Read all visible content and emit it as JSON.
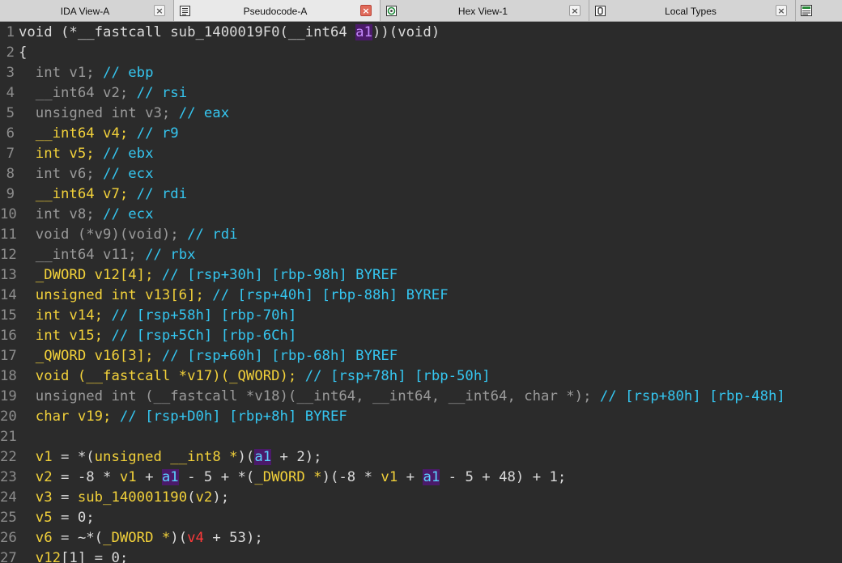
{
  "tabs": [
    {
      "label": "IDA View-A",
      "active": false,
      "icon": "none",
      "width": 215
    },
    {
      "label": "Pseudocode-A",
      "active": true,
      "icon": "document-icon",
      "width": 255
    },
    {
      "label": "Hex View-1",
      "active": false,
      "icon": "hex-icon",
      "width": 258
    },
    {
      "label": "Local Types",
      "active": false,
      "icon": "types-icon",
      "width": 255
    },
    {
      "label": "",
      "active": false,
      "icon": "structures-icon",
      "width": 57
    }
  ],
  "code_lines": [
    {
      "n": "1",
      "parts": [
        [
          "void (*__fastcall sub_1400019F0(__int64 ",
          "kw"
        ],
        [
          "a1",
          "hl"
        ],
        [
          "))(void)",
          "kw"
        ]
      ]
    },
    {
      "n": "2",
      "parts": [
        [
          "{",
          "kw"
        ]
      ]
    },
    {
      "n": "3",
      "parts": [
        [
          "  int v1; ",
          "kg"
        ],
        [
          "// ebp",
          "cm"
        ]
      ]
    },
    {
      "n": "4",
      "parts": [
        [
          "  __int64 v2; ",
          "kg"
        ],
        [
          "// rsi",
          "cm"
        ]
      ]
    },
    {
      "n": "5",
      "parts": [
        [
          "  unsigned int v3; ",
          "kg"
        ],
        [
          "// eax",
          "cm"
        ]
      ]
    },
    {
      "n": "6",
      "parts": [
        [
          "  __int64 v4; ",
          "yl"
        ],
        [
          "// r9",
          "cm"
        ]
      ]
    },
    {
      "n": "7",
      "parts": [
        [
          "  int v5; ",
          "yl"
        ],
        [
          "// ebx",
          "cm"
        ]
      ]
    },
    {
      "n": "8",
      "parts": [
        [
          "  int v6; ",
          "kg"
        ],
        [
          "// ecx",
          "cm"
        ]
      ]
    },
    {
      "n": "9",
      "parts": [
        [
          "  __int64 v7; ",
          "yl"
        ],
        [
          "// rdi",
          "cm"
        ]
      ]
    },
    {
      "n": "10",
      "parts": [
        [
          "  int v8; ",
          "kg"
        ],
        [
          "// ecx",
          "cm"
        ]
      ]
    },
    {
      "n": "11",
      "parts": [
        [
          "  void (*v9)(void); ",
          "kg"
        ],
        [
          "// rdi",
          "cm"
        ]
      ]
    },
    {
      "n": "12",
      "parts": [
        [
          "  __int64 v11; ",
          "kg"
        ],
        [
          "// rbx",
          "cm"
        ]
      ]
    },
    {
      "n": "13",
      "parts": [
        [
          "  _DWORD v12[4]; ",
          "yl"
        ],
        [
          "// [rsp+30h] [rbp-98h] BYREF",
          "cm"
        ]
      ]
    },
    {
      "n": "14",
      "parts": [
        [
          "  unsigned int v13[6]; ",
          "yl"
        ],
        [
          "// [rsp+40h] [rbp-88h] BYREF",
          "cm"
        ]
      ]
    },
    {
      "n": "15",
      "parts": [
        [
          "  int v14; ",
          "yl"
        ],
        [
          "// [rsp+58h] [rbp-70h]",
          "cm"
        ]
      ]
    },
    {
      "n": "16",
      "parts": [
        [
          "  int v15; ",
          "yl"
        ],
        [
          "// [rsp+5Ch] [rbp-6Ch]",
          "cm"
        ]
      ]
    },
    {
      "n": "17",
      "parts": [
        [
          "  _QWORD v16[3]; ",
          "yl"
        ],
        [
          "// [rsp+60h] [rbp-68h] BYREF",
          "cm"
        ]
      ]
    },
    {
      "n": "18",
      "parts": [
        [
          "  void (__fastcall *v17)(_QWORD); ",
          "yl"
        ],
        [
          "// [rsp+78h] [rbp-50h]",
          "cm"
        ]
      ]
    },
    {
      "n": "19",
      "parts": [
        [
          "  unsigned int (__fastcall *v18)(__int64, __int64, __int64, char *); ",
          "kg"
        ],
        [
          "// [rsp+80h] [rbp-48h]",
          "cm"
        ]
      ]
    },
    {
      "n": "20",
      "parts": [
        [
          "  char v19; ",
          "yl"
        ],
        [
          "// [rsp+D0h] [rbp+8h] BYREF",
          "cm"
        ]
      ]
    },
    {
      "n": "21",
      "parts": []
    },
    {
      "n": "22",
      "parts": [
        [
          "  v1",
          "yl"
        ],
        [
          " = *(",
          "pu"
        ],
        [
          "unsigned __int8 *",
          "yl"
        ],
        [
          ")(",
          "pu"
        ],
        [
          "a1",
          "hlb"
        ],
        [
          " + 2);",
          "pu"
        ]
      ]
    },
    {
      "n": "23",
      "parts": [
        [
          "  v2",
          "yl"
        ],
        [
          " = -8 * ",
          "pu"
        ],
        [
          "v1",
          "yl"
        ],
        [
          " + ",
          "pu"
        ],
        [
          "a1",
          "hlb"
        ],
        [
          " - 5 + *(",
          "pu"
        ],
        [
          "_DWORD *",
          "yl"
        ],
        [
          ")(-8 * ",
          "pu"
        ],
        [
          "v1",
          "yl"
        ],
        [
          " + ",
          "pu"
        ],
        [
          "a1",
          "hlb"
        ],
        [
          " - 5 + 48) + 1;",
          "pu"
        ]
      ]
    },
    {
      "n": "24",
      "parts": [
        [
          "  v3",
          "yl"
        ],
        [
          " = ",
          "pu"
        ],
        [
          "sub_140001190",
          "yl"
        ],
        [
          "(",
          "pu"
        ],
        [
          "v2",
          "yl"
        ],
        [
          ");",
          "pu"
        ]
      ]
    },
    {
      "n": "25",
      "parts": [
        [
          "  v5",
          "yl"
        ],
        [
          " = 0;",
          "pu"
        ]
      ]
    },
    {
      "n": "26",
      "parts": [
        [
          "  v6",
          "yl"
        ],
        [
          " = ~*(",
          "pu"
        ],
        [
          "_DWORD *",
          "yl"
        ],
        [
          ")(",
          "pu"
        ],
        [
          "v4",
          "rd"
        ],
        [
          " + 53);",
          "pu"
        ]
      ]
    },
    {
      "n": "27",
      "parts": [
        [
          "  v12",
          "yl"
        ],
        [
          "[1] = 0;",
          "pu"
        ]
      ]
    }
  ]
}
